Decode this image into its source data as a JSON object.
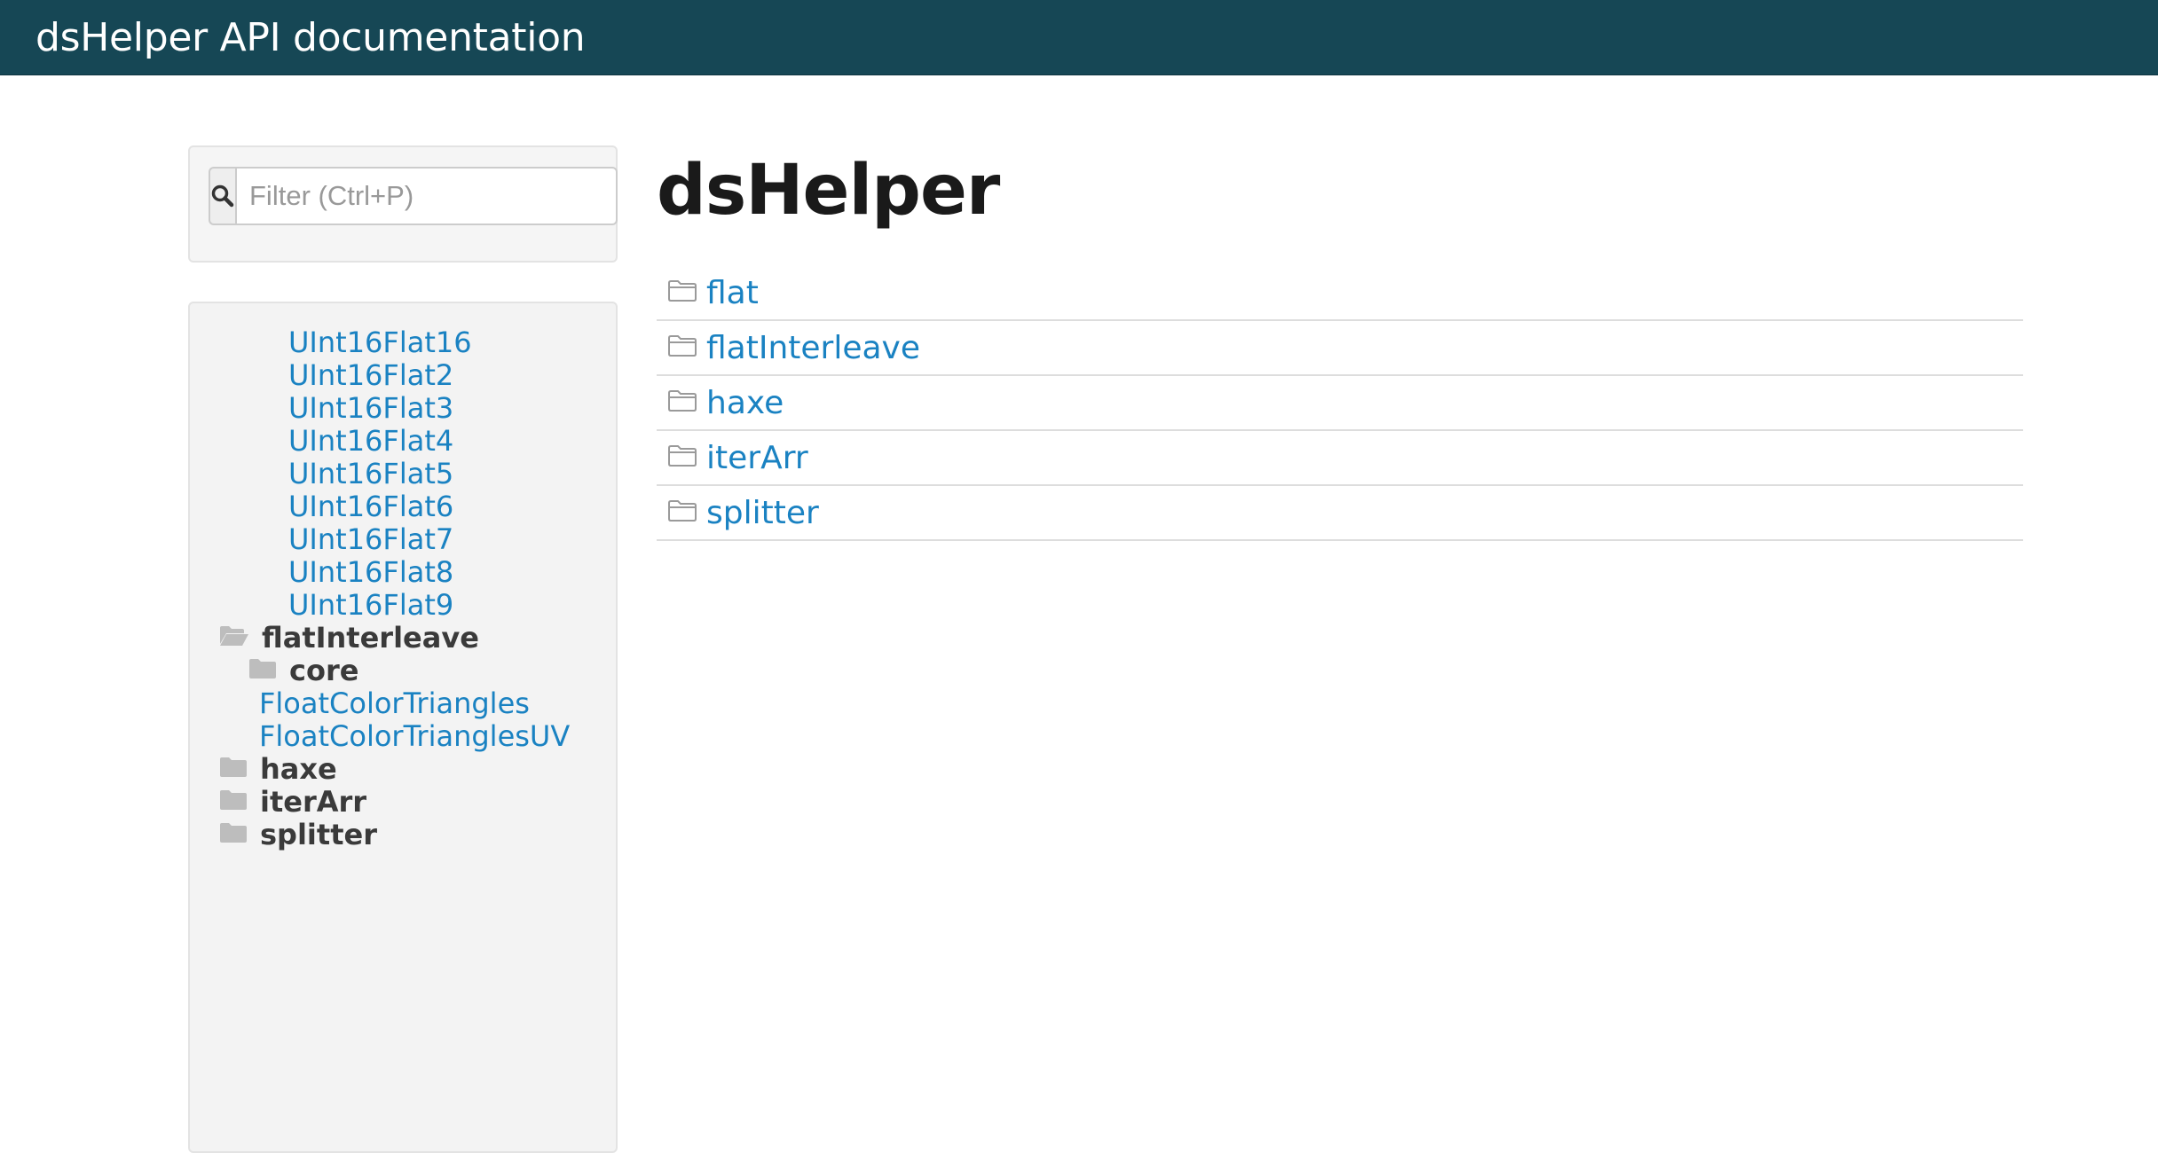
{
  "header": {
    "title": "dsHelper API documentation"
  },
  "filter": {
    "placeholder": "Filter (Ctrl+P)"
  },
  "nav": {
    "flat_types": [
      "UInt16Flat16",
      "UInt16Flat2",
      "UInt16Flat3",
      "UInt16Flat4",
      "UInt16Flat5",
      "UInt16Flat6",
      "UInt16Flat7",
      "UInt16Flat8",
      "UInt16Flat9"
    ],
    "flatInterleave": {
      "label": "flatInterleave",
      "core_label": "core",
      "types": [
        "FloatColorTriangles",
        "FloatColorTrianglesUV"
      ]
    },
    "packages": [
      "haxe",
      "iterArr",
      "splitter"
    ]
  },
  "main": {
    "title": "dsHelper",
    "packages": [
      "flat",
      "flatInterleave",
      "haxe",
      "iterArr",
      "splitter"
    ]
  },
  "colors": {
    "header_bg": "#164755",
    "link": "#1a82c2",
    "well_bg": "#f3f3f3"
  },
  "icons": {
    "search": "search-icon",
    "folder_open": "folder-open-icon",
    "folder": "folder-icon",
    "folder_outline": "folder-outline-icon"
  }
}
